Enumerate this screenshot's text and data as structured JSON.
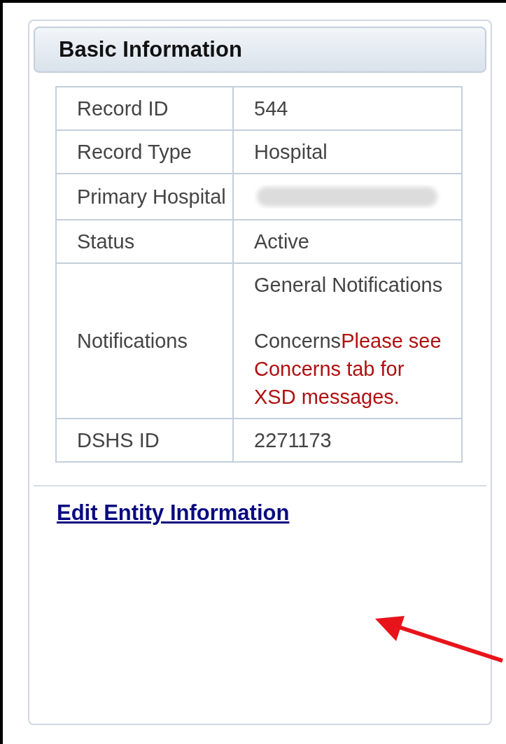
{
  "panel": {
    "title": "Basic Information"
  },
  "rows": [
    {
      "label": "Record ID",
      "kind": "text",
      "value": "544"
    },
    {
      "label": "Record Type",
      "kind": "text",
      "value": "Hospital"
    },
    {
      "label": "Primary Hospital",
      "kind": "redacted"
    },
    {
      "label": "Status",
      "kind": "text",
      "value": "Active"
    },
    {
      "label": "Notifications",
      "kind": "notifications",
      "parts": [
        {
          "text": "General Notifications"
        },
        {
          "text": "Concerns",
          "alert": "Please see Concerns tab for XSD messages."
        }
      ]
    },
    {
      "label": "DSHS ID",
      "kind": "text",
      "value": "2271173"
    }
  ],
  "link": {
    "label": "Edit Entity Information"
  },
  "annotation": {
    "kind": "arrow"
  }
}
